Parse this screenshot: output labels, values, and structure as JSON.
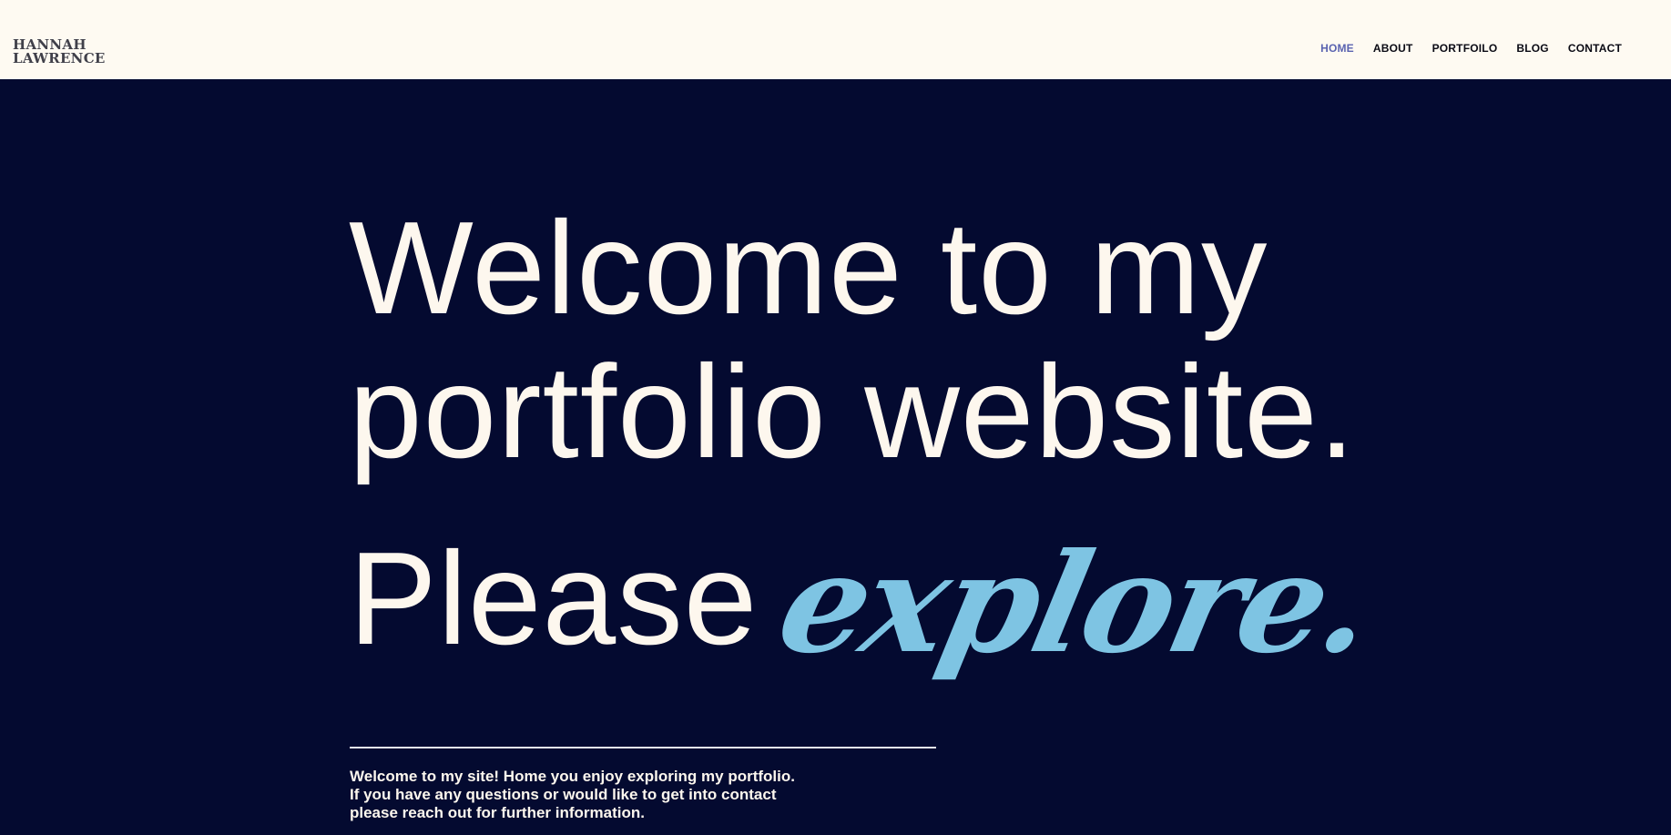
{
  "header": {
    "logo_line1": "HANNAH",
    "logo_line2": "LAWRENCE",
    "nav": [
      {
        "label": "HOME",
        "active": true
      },
      {
        "label": "ABOUT",
        "active": false
      },
      {
        "label": "PORTFOILO",
        "active": false
      },
      {
        "label": "BLOG",
        "active": false
      },
      {
        "label": "CONTACT",
        "active": false
      }
    ]
  },
  "hero": {
    "headline_line1": "Welcome to my",
    "headline_line2": "portfolio website.",
    "please": "Please",
    "explore": "explore.",
    "intro_line1": "Welcome to my site! Home you enjoy exploring my portfolio.",
    "intro_line2": "If you have any questions or would like to get into contact",
    "intro_line3": "please reach out for further information."
  },
  "colors": {
    "header_bg": "#fefaf2",
    "hero_bg": "#040a30",
    "text_light": "#fdf7ee",
    "accent_script": "#7ec4e3",
    "nav_active": "#5a63b0"
  }
}
